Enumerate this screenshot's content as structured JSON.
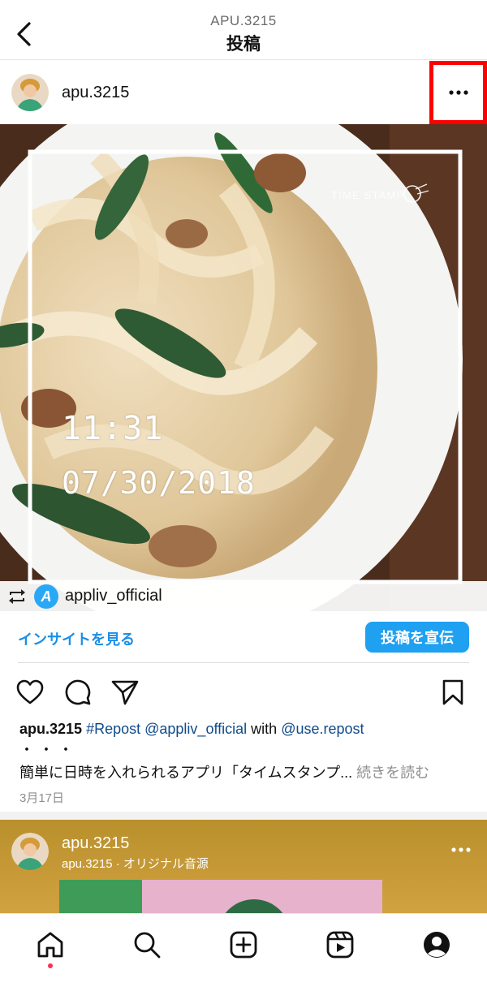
{
  "topbar": {
    "subtitle": "APU.3215",
    "title": "投稿",
    "back_icon": "chevron-left-icon"
  },
  "post": {
    "username": "apu.3215",
    "more_icon": "more-horizontal-icon",
    "highlight_color": "#ff0000",
    "photo": {
      "stamp_brand": "TIME STAMP",
      "stamp_time": "11:31",
      "stamp_date": "07/30/2018"
    },
    "repost": {
      "icon": "repost-icon",
      "app_logo_letter": "A",
      "handle": "appliv_official"
    },
    "insights_label": "インサイトを見る",
    "promote_label": "投稿を宣伝",
    "actions": {
      "like_icon": "heart-icon",
      "comment_icon": "comment-icon",
      "share_icon": "send-icon",
      "save_icon": "bookmark-icon"
    },
    "caption": {
      "username": "apu.3215",
      "hashtag": "#Repost",
      "mention": "@appliv_official",
      "with_word": "with",
      "mention2": "@use.repost",
      "line2": "・・・",
      "line3": "簡単に日時を入れられるアプリ「タイムスタンプ...",
      "more_label": "続きを読む"
    },
    "date": "3月17日"
  },
  "next_post": {
    "username": "apu.3215",
    "audio": "apu.3215 · オリジナル音源"
  },
  "bottom_nav": {
    "items": [
      "home-icon",
      "search-icon",
      "new-post-icon",
      "reels-icon",
      "profile-icon"
    ],
    "active": "home-icon"
  },
  "colors": {
    "accent_blue": "#1fa0f0",
    "link_blue": "#1a8fe6",
    "tag_blue": "#0f4b8a",
    "notification_dot": "#ff2d55"
  }
}
